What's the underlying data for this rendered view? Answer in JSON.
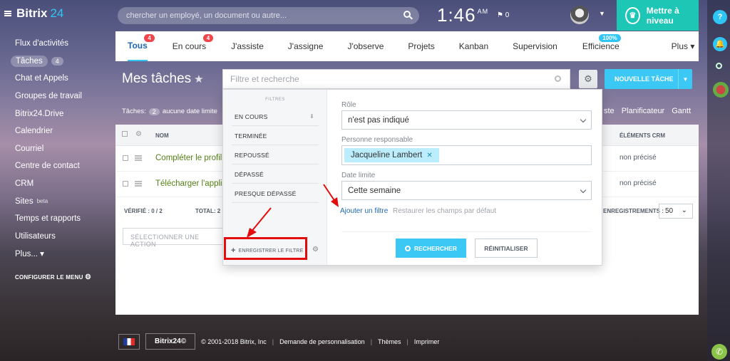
{
  "header": {
    "logo_text": "Bitrix",
    "logo_num": "24",
    "search_placeholder": "chercher un employé, un document ou autre...",
    "clock": "1:46",
    "clock_ampm": "AM",
    "flag_count": "0",
    "upgrade_label": "Mettre à niveau"
  },
  "menu": {
    "items": [
      {
        "label": "Flux d'activités"
      },
      {
        "label": "Tâches",
        "count": "4"
      },
      {
        "label": "Chat et Appels"
      },
      {
        "label": "Groupes de travail"
      },
      {
        "label": "Bitrix24.Drive"
      },
      {
        "label": "Calendrier"
      },
      {
        "label": "Courriel"
      },
      {
        "label": "Centre de contact"
      },
      {
        "label": "CRM"
      },
      {
        "label": "Sites",
        "sup": "beta"
      },
      {
        "label": "Temps et rapports"
      },
      {
        "label": "Utilisateurs"
      },
      {
        "label": "Plus... ▾"
      }
    ],
    "config_label": "CONFIGURER LE MENU"
  },
  "tabs": [
    {
      "label": "Tous",
      "badge": "4"
    },
    {
      "label": "En cours",
      "badge": "4"
    },
    {
      "label": "J'assiste"
    },
    {
      "label": "J'assigne"
    },
    {
      "label": "J'observe"
    },
    {
      "label": "Projets"
    },
    {
      "label": "Kanban"
    },
    {
      "label": "Supervision"
    },
    {
      "label": "Efficience",
      "badge": "100%"
    },
    {
      "label": "Plus ▾"
    }
  ],
  "page": {
    "title": "Mes tâches",
    "filter_placeholder": "Filtre et recherche",
    "new_task_label": "NOUVELLE TÂCHE",
    "tasks_label": "Tâches:",
    "tasks_count": "2",
    "no_deadline": "aucune date limite",
    "view_links": [
      "ste",
      "Planificateur",
      "Gantt"
    ]
  },
  "table": {
    "col_name": "NOM",
    "col_crm": "ÉLÉMENTS CRM",
    "rows": [
      {
        "name": "Compléter le profil",
        "crm": "non précisé"
      },
      {
        "name": "Télécharger l'applicatio",
        "crm": "non précisé"
      }
    ],
    "verified": "VÉRIFIÉ : 0 / 2",
    "total": "TOTAL: 2",
    "records_label": "ENREGISTREMENTS :",
    "per_page": "50",
    "action_label": "SÉLECTIONNER UNE ACTION"
  },
  "filter": {
    "header": "FILTRES",
    "presets": [
      "EN COURS",
      "TERMINÉE",
      "REPOUSSÉ",
      "DÉPASSÉ",
      "PRESQUE DÉPASSÉ"
    ],
    "save_label": "ENREGISTRER LE FILTRE",
    "role_label": "Rôle",
    "role_value": "n'est pas indiqué",
    "responsible_label": "Personne responsable",
    "responsible_value": "Jacqueline Lambert",
    "deadline_label": "Date limite",
    "deadline_value": "Cette semaine",
    "add_filter": "Ajouter un filtre",
    "reset_fields": "Restaurer les champs par défaut",
    "search_btn": "RECHERCHER",
    "reset_btn": "RÉINITIALISER"
  },
  "footer": {
    "brand": "Bitrix24",
    "copyright": "© 2001-2018 Bitrix, Inc",
    "links": [
      "Demande de personnalisation",
      "Thèmes",
      "Imprimer"
    ]
  },
  "colors": {
    "accent": "#3bc8f5",
    "upgrade": "#1ec6b5",
    "highlight": "#e30b0b",
    "task_link": "#537f14"
  }
}
